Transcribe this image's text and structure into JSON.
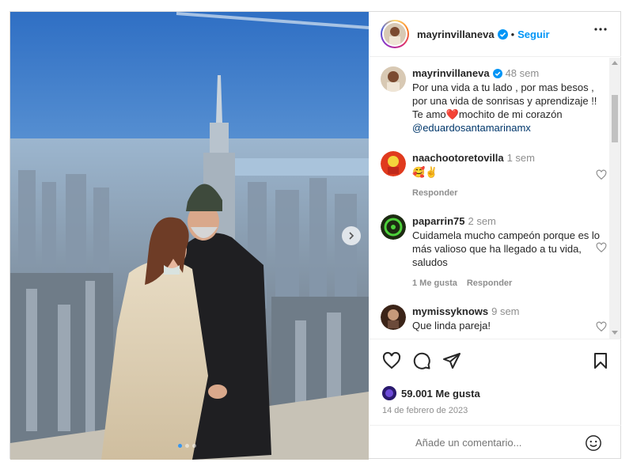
{
  "post": {
    "username": "mayrinvillaneva",
    "separator": "•",
    "follow_label": "Seguir",
    "caption": {
      "time": "48 sem",
      "text": "Por una vida a tu lado , por mas besos , por una vida de sonrisas y aprendizaje !! Te amo",
      "heart_emoji": "❤️",
      "text_after": "mochito de mi corazón",
      "mention": "@eduardosantamarinamx"
    },
    "likes": "59.001 Me gusta",
    "date": "14 de febrero de 2023",
    "add_comment_placeholder": "Añade un comentario...",
    "carousel": {
      "slides": 3,
      "active": 0
    }
  },
  "comments": [
    {
      "username": "naachootoretovilla",
      "time": "1 sem",
      "text": "🥰✌️",
      "actions": [
        "Responder"
      ]
    },
    {
      "username": "paparrin75",
      "time": "2 sem",
      "text": "Cuidamela mucho campeón porque es lo más valioso que ha llegado a tu vida, saludos",
      "actions": [
        "1 Me gusta",
        "Responder"
      ]
    },
    {
      "username": "mymissyknows",
      "time": "9 sem",
      "text": "Que linda pareja!",
      "actions": []
    }
  ],
  "icons": {
    "verified": "verified-badge-icon",
    "more": "more-options-icon",
    "like": "heart-icon",
    "comment": "comment-icon",
    "share": "share-icon",
    "save": "bookmark-icon",
    "emoji": "emoji-icon",
    "next": "chevron-right-icon"
  },
  "colors": {
    "link_blue": "#0095f6",
    "verified_blue": "#0095f6",
    "secondary_text": "#8e8e8e",
    "mention_blue": "#00376b",
    "heart_red": "#ed4956"
  }
}
